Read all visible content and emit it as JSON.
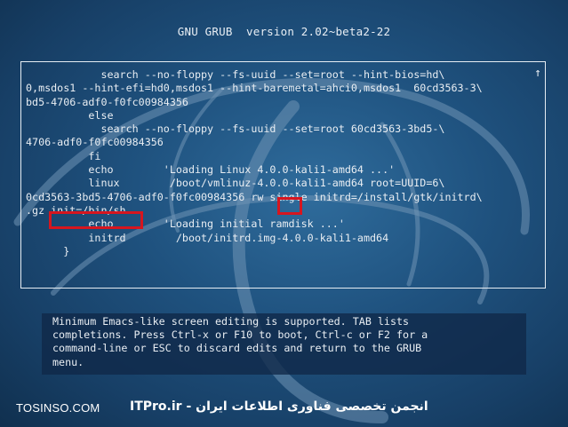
{
  "header": {
    "title": "GNU GRUB  version 2.02~beta2-22"
  },
  "editor": {
    "lines": [
      "            search --no-floppy --fs-uuid --set=root --hint-bios=hd\\",
      "0,msdos1 --hint-efi=hd0,msdos1 --hint-baremetal=ahci0,msdos1  60cd3563-3\\",
      "bd5-4706-adf0-f0fc00984356",
      "          else",
      "            search --no-floppy --fs-uuid --set=root 60cd3563-3bd5-\\",
      "4706-adf0-f0fc00984356",
      "          fi",
      "          echo        'Loading Linux 4.0.0-kali1-amd64 ...'",
      "          linux        /boot/vmlinuz-4.0.0-kali1-amd64 root=UUID=6\\",
      "0cd3563-3bd5-4706-adf0-f0fc00984356 rw single initrd=/install/gtk/initrd\\",
      ".gz init=/bin/sh",
      "          echo        'Loading initial ramdisk ...'",
      "          initrd        /boot/initrd.img-4.0.0-kali1-amd64",
      "      }"
    ],
    "scroll_indicator": "↑"
  },
  "help": {
    "lines": [
      "Minimum Emacs-like screen editing is supported. TAB lists",
      "completions. Press Ctrl-x or F10 to boot, Ctrl-c or F2 for a",
      "command-line or ESC to discard edits and return to the GRUB",
      "menu."
    ]
  },
  "watermark": {
    "site": "TOSINSO.COM",
    "text_fa": "انجمن تخصصی فناوری اطلاعات ایران - ITPro.ir"
  },
  "colors": {
    "highlight": "#d6161f",
    "text": "#e9eef3",
    "background": "#1f527f"
  }
}
